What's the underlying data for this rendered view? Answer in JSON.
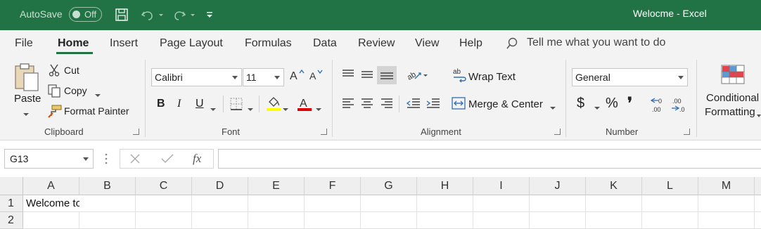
{
  "titlebar": {
    "autosave_label": "AutoSave",
    "autosave_state": "Off",
    "window_title": "Welocme  -  Excel",
    "accent_color": "#217346"
  },
  "menu": {
    "tabs": [
      "File",
      "Home",
      "Insert",
      "Page Layout",
      "Formulas",
      "Data",
      "Review",
      "View",
      "Help"
    ],
    "active_tab": "Home",
    "tell_me": "Tell me what you want to do"
  },
  "ribbon": {
    "clipboard": {
      "paste": "Paste",
      "cut": "Cut",
      "copy": "Copy",
      "format_painter": "Format Painter",
      "group_label": "Clipboard"
    },
    "font": {
      "font_name": "Calibri",
      "font_size": "11",
      "bold": "B",
      "italic": "I",
      "underline": "U",
      "group_label": "Font",
      "highlight_color": "#ffff00",
      "font_color": "#e00000"
    },
    "alignment": {
      "wrap_text": "Wrap Text",
      "merge_center": "Merge & Center",
      "group_label": "Alignment"
    },
    "number": {
      "format": "General",
      "currency": "$",
      "percent": "%",
      "comma": "❜",
      "group_label": "Number"
    },
    "styles": {
      "conditional": "Conditional",
      "formatting": "Formatting"
    }
  },
  "formula_bar": {
    "name_box": "G13",
    "fx": "fx",
    "value": ""
  },
  "grid": {
    "columns": [
      "A",
      "B",
      "C",
      "D",
      "E",
      "F",
      "G",
      "H",
      "I",
      "J",
      "K",
      "L",
      "M"
    ],
    "rows": [
      "1",
      "2"
    ],
    "cells": {
      "A1": "Welcome to Python"
    }
  }
}
